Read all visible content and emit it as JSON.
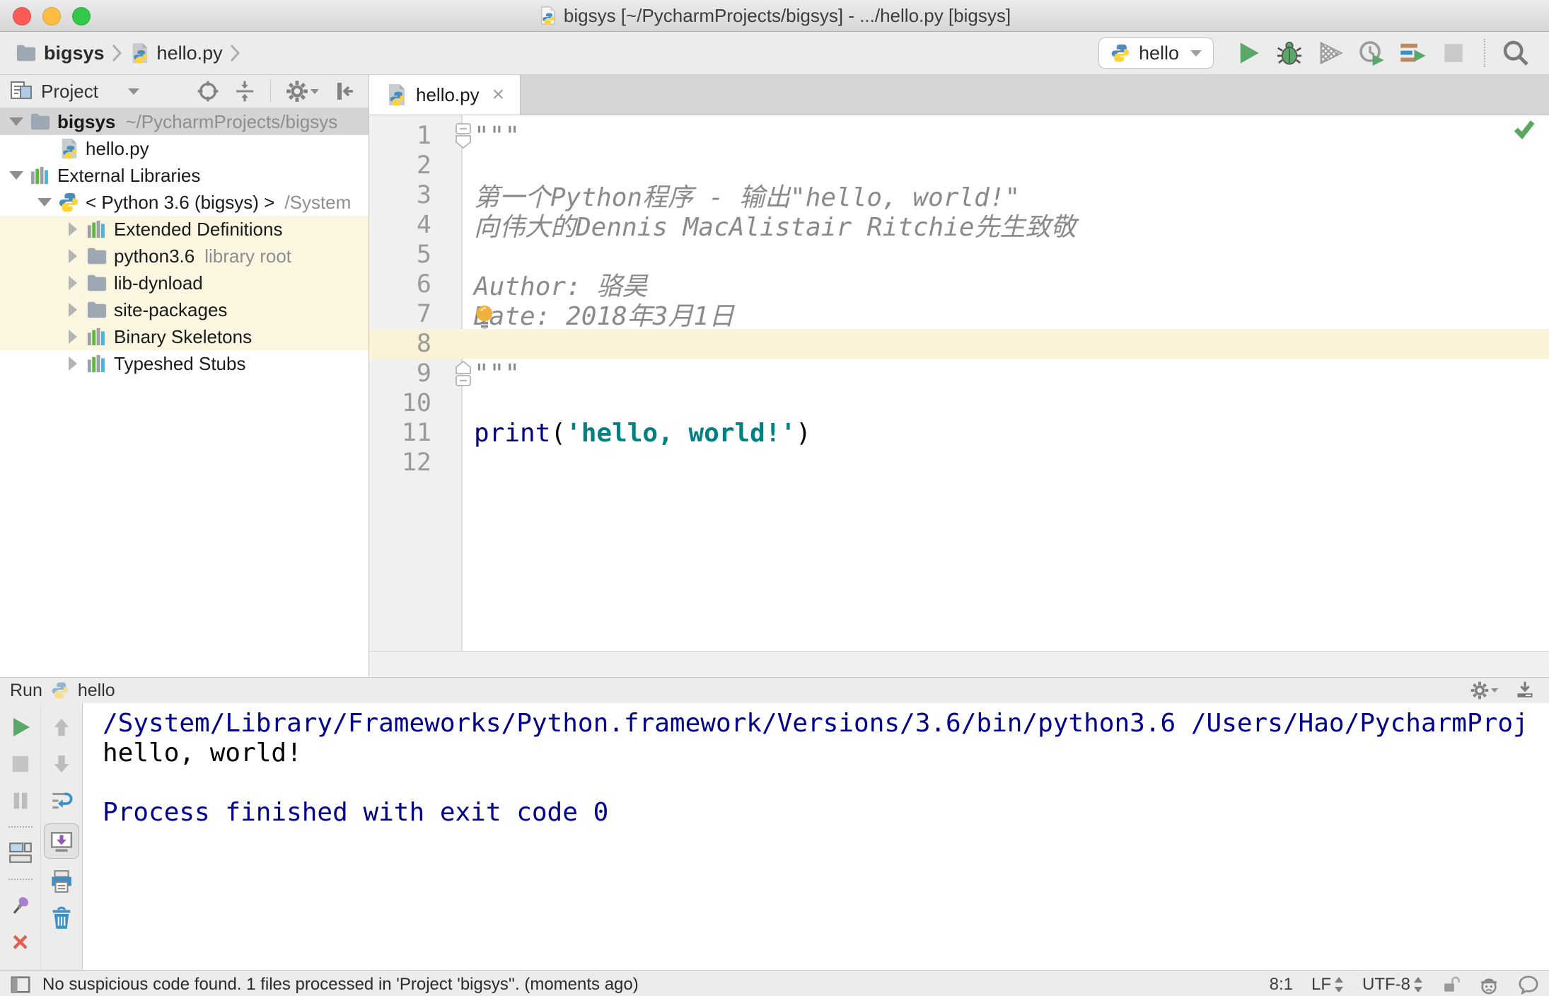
{
  "glyphs": {
    "close_tab": "×",
    "more": "»",
    "ellipsis_caret": "▾"
  },
  "colors": {
    "traffic_red": "#fc5b57",
    "traffic_yellow": "#fdbe41",
    "traffic_green": "#34c84a",
    "selection_gray": "#d4d4d4",
    "tree_highlight": "#faf6df",
    "current_line": "#fbf3d7",
    "keyword": "#000080",
    "string": "#008080",
    "docstring": "#8a8a8a",
    "console_blue": "#00008b"
  },
  "title_bar": {
    "title": "bigsys [~/PycharmProjects/bigsys] - .../hello.py [bigsys]"
  },
  "toolbar": {
    "breadcrumbs": [
      {
        "label": "bigsys"
      },
      {
        "label": "hello.py"
      }
    ],
    "run_config": "hello"
  },
  "project_panel": {
    "title": "Project",
    "tree": [
      {
        "label": "bigsys",
        "hint": "~/PycharmProjects/bigsys",
        "icon": "folder",
        "arrow": "down",
        "level": 0,
        "selected": true,
        "bold": true
      },
      {
        "label": "hello.py",
        "icon": "pyfile",
        "arrow": "none",
        "level": 1
      },
      {
        "label": "External Libraries",
        "icon": "library",
        "arrow": "down",
        "level": 0
      },
      {
        "label": "< Python 3.6 (bigsys) >",
        "hint": "/System",
        "icon": "python",
        "arrow": "down",
        "level": 1
      },
      {
        "label": "Extended Definitions",
        "icon": "library",
        "arrow": "right",
        "level": 2,
        "highlight": true
      },
      {
        "label": "python3.6",
        "hint": "library root",
        "icon": "folder",
        "arrow": "right",
        "level": 2,
        "highlight": true
      },
      {
        "label": "lib-dynload",
        "icon": "folder",
        "arrow": "right",
        "level": 2,
        "highlight": true
      },
      {
        "label": "site-packages",
        "icon": "folder",
        "arrow": "right",
        "level": 2,
        "highlight": true
      },
      {
        "label": "Binary Skeletons",
        "icon": "library",
        "arrow": "right",
        "level": 2,
        "highlight": true
      },
      {
        "label": "Typeshed Stubs",
        "icon": "library",
        "arrow": "right",
        "level": 2
      }
    ]
  },
  "editor": {
    "tab": "hello.py",
    "lines": [
      {
        "n": 1,
        "tokens": [
          {
            "t": "\"\"\"",
            "s": "doc"
          }
        ],
        "fold": "open"
      },
      {
        "n": 2,
        "tokens": []
      },
      {
        "n": 3,
        "tokens": [
          {
            "t": "第一个Python程序 - 输出\"hello, world!\"",
            "s": "doc"
          }
        ]
      },
      {
        "n": 4,
        "tokens": [
          {
            "t": "向伟大的Dennis MacAlistair Ritchie先生致敬",
            "s": "doc"
          }
        ]
      },
      {
        "n": 5,
        "tokens": []
      },
      {
        "n": 6,
        "tokens": [
          {
            "t": "Author: 骆昊",
            "s": "doc"
          }
        ]
      },
      {
        "n": 7,
        "tokens": [
          {
            "t": "Date: 2018年3月1日",
            "s": "doc"
          }
        ],
        "bulb": true
      },
      {
        "n": 8,
        "tokens": [],
        "current": true
      },
      {
        "n": 9,
        "tokens": [
          {
            "t": "\"\"\"",
            "s": "doc"
          }
        ],
        "fold": "close"
      },
      {
        "n": 10,
        "tokens": []
      },
      {
        "n": 11,
        "tokens": [
          {
            "t": "print",
            "s": "kw"
          },
          {
            "t": "(",
            "s": "pl"
          },
          {
            "t": "'hello, world!'",
            "s": "str"
          },
          {
            "t": ")",
            "s": "pl"
          }
        ]
      },
      {
        "n": 12,
        "tokens": []
      }
    ]
  },
  "run_panel": {
    "title": "Run",
    "config": "hello",
    "console": [
      {
        "text": "/System/Library/Frameworks/Python.framework/Versions/3.6/bin/python3.6 /Users/Hao/PycharmProj",
        "color": "blue"
      },
      {
        "text": "hello, world!",
        "color": "black"
      },
      {
        "text": "",
        "color": "black"
      },
      {
        "text": "Process finished with exit code 0",
        "color": "blue"
      }
    ]
  },
  "status_bar": {
    "message": "No suspicious code found. 1 files processed in 'Project 'bigsys''. (moments ago)",
    "caret": "8:1",
    "line_ending": "LF",
    "encoding": "UTF-8"
  }
}
